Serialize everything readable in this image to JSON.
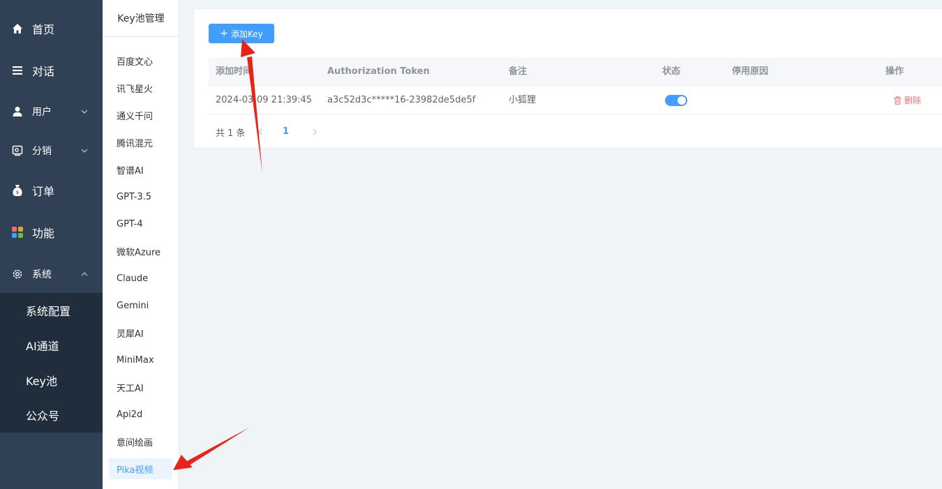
{
  "nav": {
    "items": [
      {
        "label": "首页",
        "icon": "home-icon"
      },
      {
        "label": "对话",
        "icon": "list-icon"
      },
      {
        "label": "用户",
        "icon": "user-icon"
      },
      {
        "label": "分销",
        "icon": "distribution-icon"
      },
      {
        "label": "订单",
        "icon": "money-bag-icon"
      },
      {
        "label": "功能",
        "icon": "apps-icon"
      },
      {
        "label": "系统",
        "icon": "gear-icon"
      }
    ],
    "system_submenu": [
      "系统配置",
      "AI通道",
      "Key池",
      "公众号"
    ]
  },
  "keypool": {
    "title": "Key池管理",
    "items": [
      "百度文心",
      "讯飞星火",
      "通义千问",
      "腾讯混元",
      "智谱AI",
      "GPT-3.5",
      "GPT-4",
      "微软Azure",
      "Claude",
      "Gemini",
      "灵犀AI",
      "MiniMax",
      "天工AI",
      "Api2d",
      "意间绘画",
      "Pika视频"
    ],
    "active": "Pika视频"
  },
  "toolbar": {
    "add_label": "添加Key"
  },
  "table": {
    "columns": [
      "添加时间",
      "Authorization Token",
      "备注",
      "状态",
      "停用原因",
      "操作"
    ],
    "rows": [
      {
        "time": "2024-03-09 21:39:45",
        "token": "a3c52d3c*****16-23982de5de5f",
        "note": "小狐狸",
        "enabled": true,
        "reason": "",
        "action": "删除"
      }
    ]
  },
  "pagination": {
    "total_text": "共 1 条",
    "current_page": "1"
  },
  "colors": {
    "primary": "#409eff",
    "sidebar": "#304156",
    "submenu": "#1f2d3d",
    "danger": "#f56c6c",
    "annotation": "#e8231a"
  }
}
